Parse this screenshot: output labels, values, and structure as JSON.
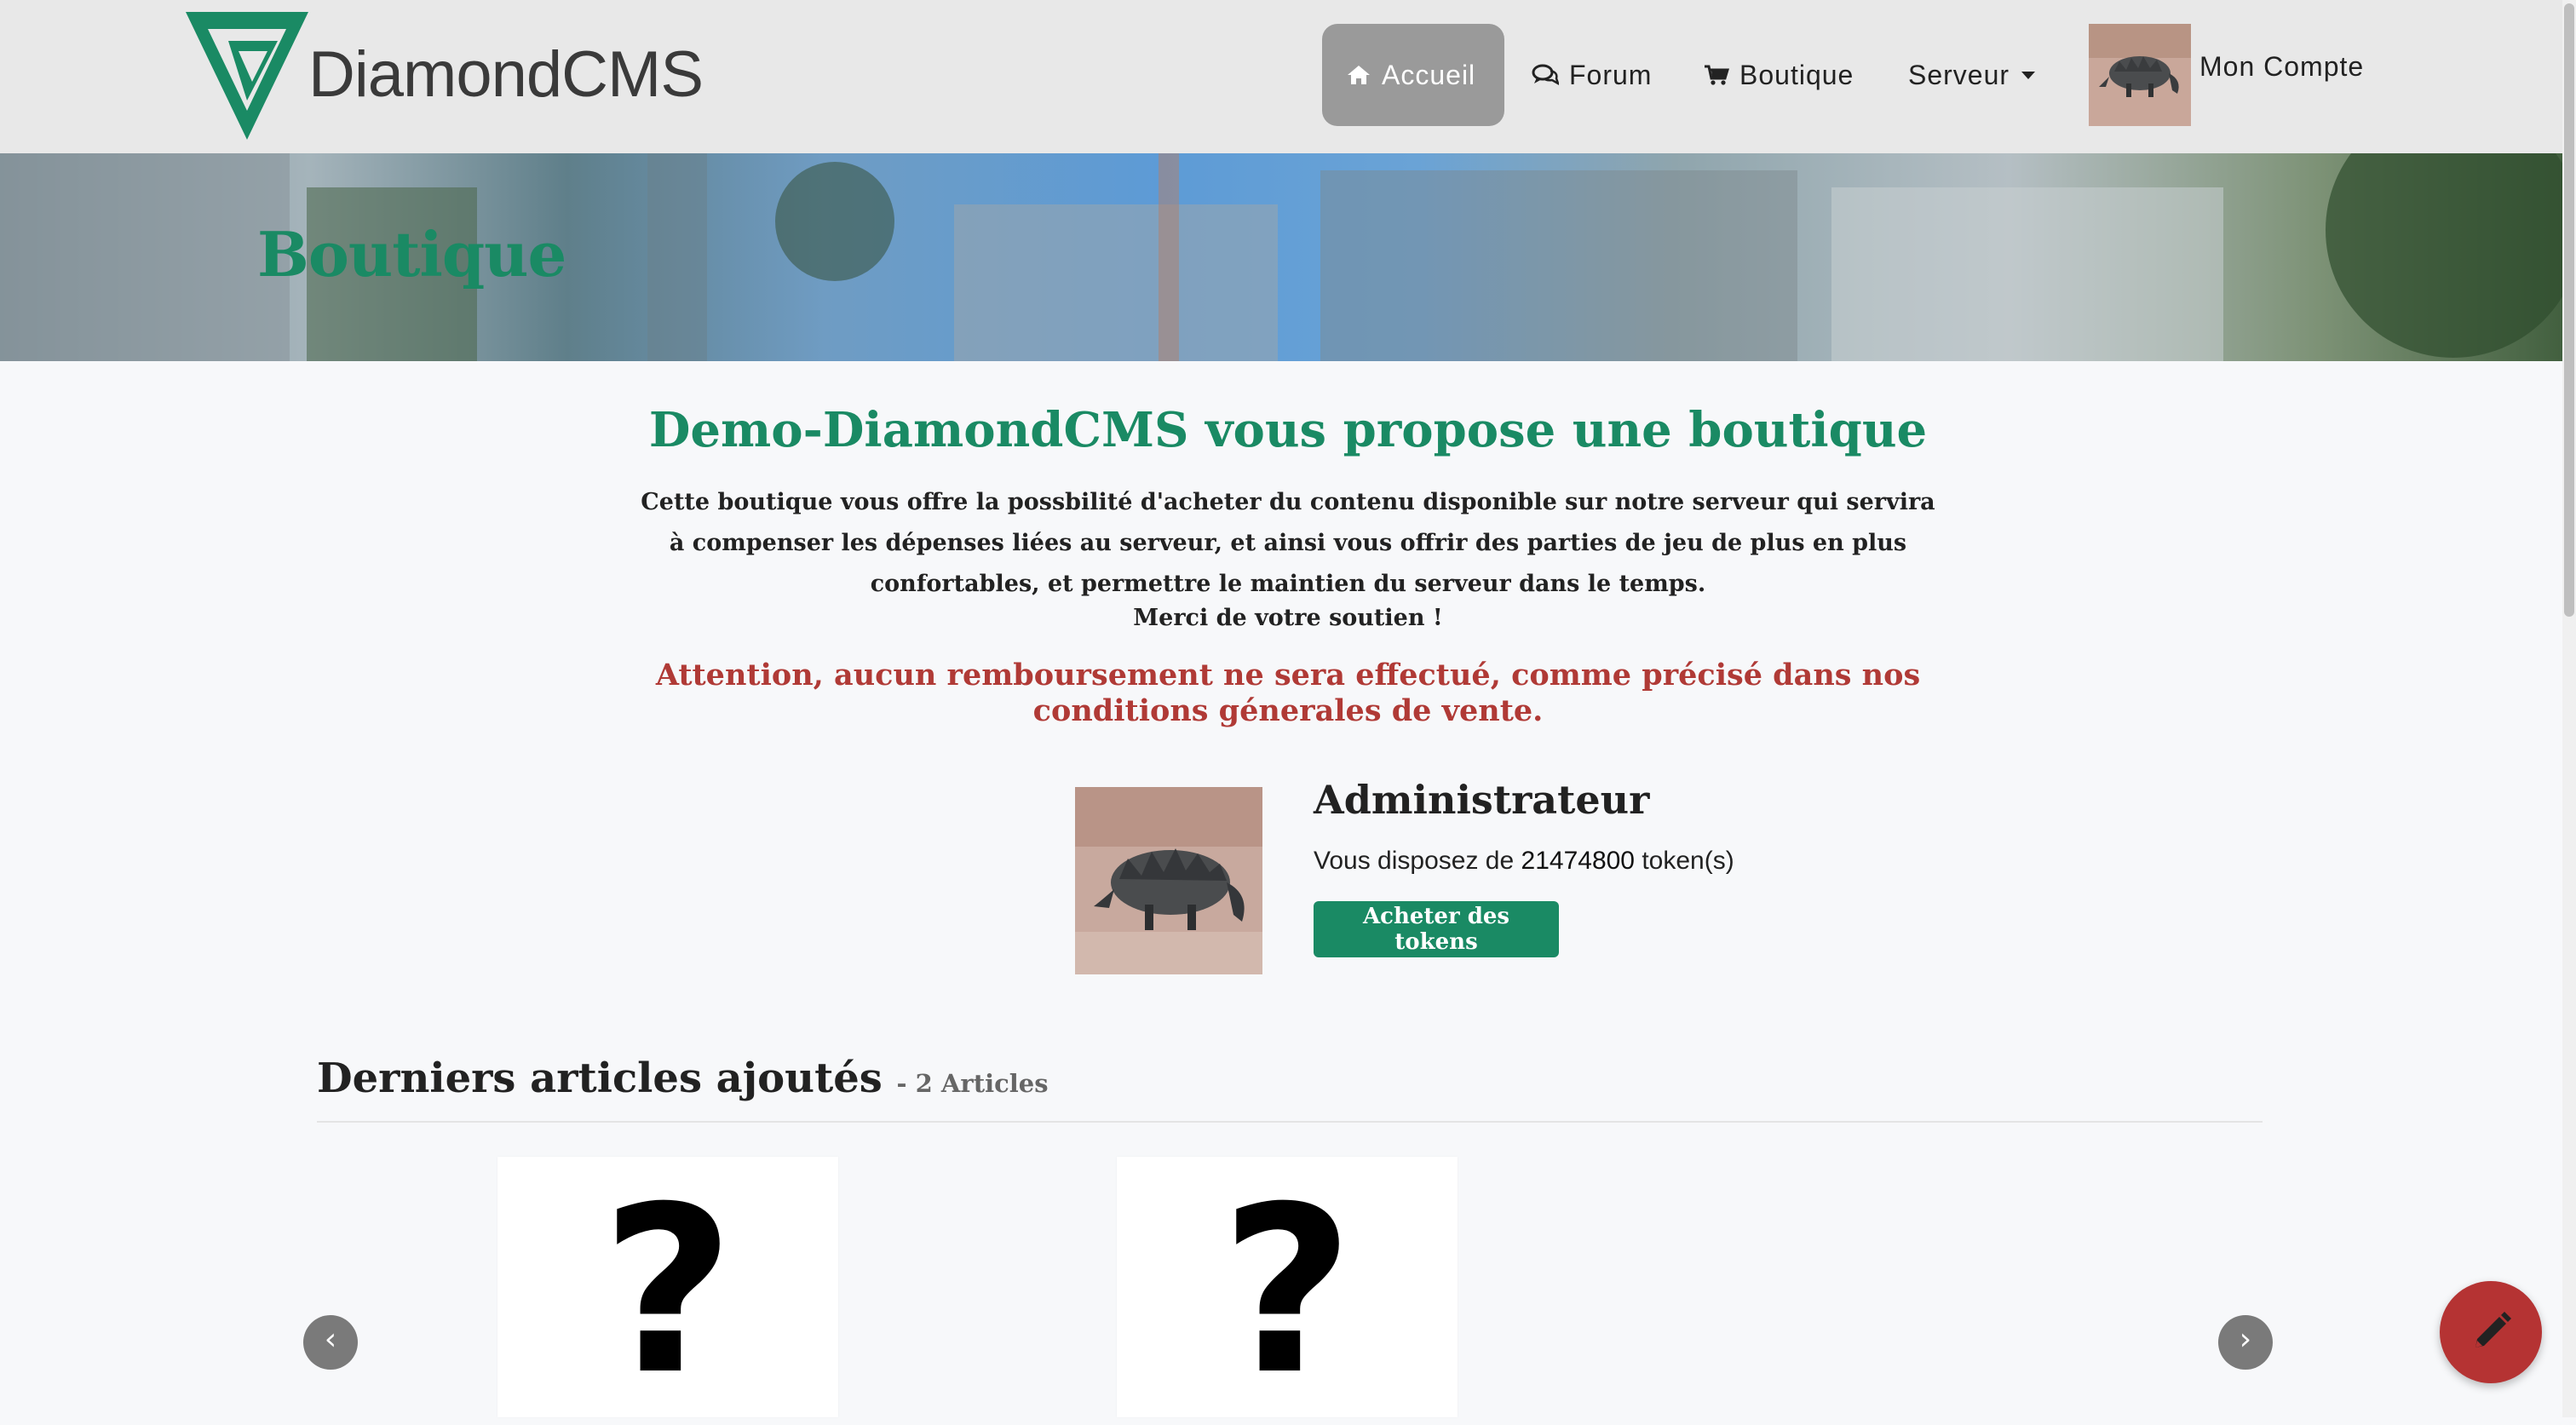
{
  "navbar": {
    "brand": "DiamondCMS",
    "items": [
      {
        "label": "Accueil",
        "icon": "home-icon"
      },
      {
        "label": "Forum",
        "icon": "comments-icon"
      },
      {
        "label": "Boutique",
        "icon": "cart-icon"
      },
      {
        "label": "Serveur",
        "icon": "caret-down-icon"
      }
    ],
    "account_label": "Mon Compte"
  },
  "hero": {
    "title": "Boutique"
  },
  "intro": {
    "title": "Demo-DiamondCMS vous propose une boutique",
    "text": "Cette boutique vous offre la possbilité d'acheter du contenu disponible sur notre serveur qui servira à compenser les dépenses liées au serveur, et ainsi vous offrir des parties de jeu de plus en plus confortables, et permettre le maintien du serveur dans le temps.",
    "thanks": "Merci de votre soutien !",
    "warning": "Attention, aucun remboursement ne sera effectué, comme précisé dans nos conditions génerales de vente."
  },
  "user": {
    "name": "Administrateur",
    "balance_prefix": "Vous disposez de",
    "balance_value": "21474800",
    "balance_suffix": "token(s)",
    "buy_button": "Acheter des tokens"
  },
  "latest": {
    "title": "Derniers articles ajoutés",
    "count": "- 2 Articles",
    "items": [
      {
        "image_icon": "question-mark-icon"
      },
      {
        "image_icon": "question-mark-icon"
      }
    ],
    "prev_label": "‹",
    "next_label": "›"
  },
  "colors": {
    "brand_green": "#1a8a64",
    "warning_red": "#b03a36",
    "fab_red": "#b53333",
    "navbar_bg": "#e8e8e8"
  }
}
